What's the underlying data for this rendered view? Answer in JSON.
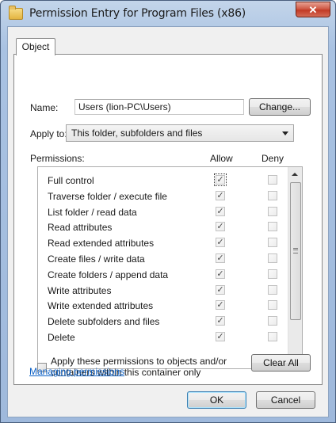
{
  "window": {
    "title": "Permission Entry for Program Files (x86)",
    "close_glyph": "✕"
  },
  "tabs": [
    {
      "label": "Object"
    }
  ],
  "name_field": {
    "label": "Name:",
    "value": "Users (lion-PC\\Users)"
  },
  "change_button": {
    "label": "Change..."
  },
  "apply_to": {
    "label": "Apply to:",
    "selected": "This folder, subfolders and files"
  },
  "permissions": {
    "header": "Permissions:",
    "allow_header": "Allow",
    "deny_header": "Deny",
    "rows": [
      {
        "label": "Full control",
        "allow": true,
        "deny": false
      },
      {
        "label": "Traverse folder / execute file",
        "allow": true,
        "deny": false
      },
      {
        "label": "List folder / read data",
        "allow": true,
        "deny": false
      },
      {
        "label": "Read attributes",
        "allow": true,
        "deny": false
      },
      {
        "label": "Read extended attributes",
        "allow": true,
        "deny": false
      },
      {
        "label": "Create files / write data",
        "allow": true,
        "deny": false
      },
      {
        "label": "Create folders / append data",
        "allow": true,
        "deny": false
      },
      {
        "label": "Write attributes",
        "allow": true,
        "deny": false
      },
      {
        "label": "Write extended attributes",
        "allow": true,
        "deny": false
      },
      {
        "label": "Delete subfolders and files",
        "allow": true,
        "deny": false
      },
      {
        "label": "Delete",
        "allow": true,
        "deny": false
      }
    ]
  },
  "apply_checkbox": {
    "label_line1": "Apply these permissions to objects and/or",
    "label_line2": "containers within this container only",
    "checked": false
  },
  "clear_all_button": {
    "label": "Clear All"
  },
  "help_link": {
    "label": "Managing permissions"
  },
  "ok_button": {
    "label": "OK"
  },
  "cancel_button": {
    "label": "Cancel"
  },
  "colors": {
    "link": "#0b60c6",
    "title_bar": "#a9c2e2",
    "close_button": "#c23a25"
  }
}
